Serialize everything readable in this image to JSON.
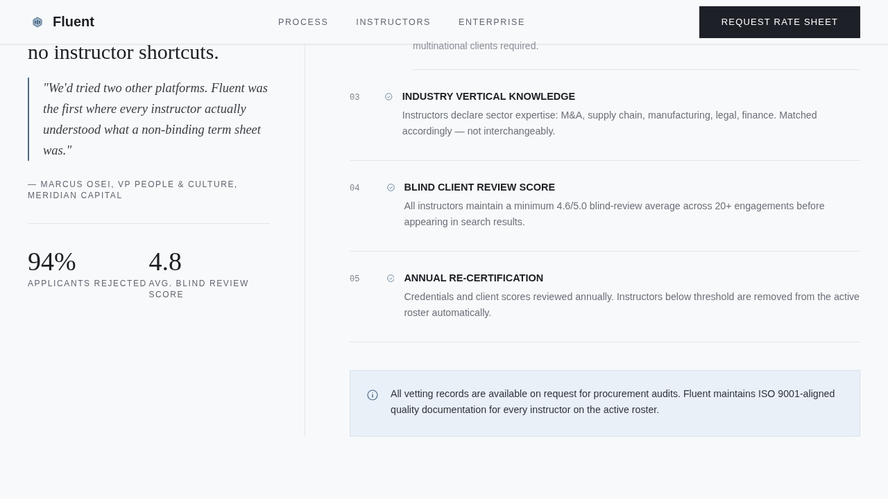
{
  "header": {
    "brand": "Fluent",
    "nav": [
      {
        "label": "PROCESS"
      },
      {
        "label": "INSTRUCTORS"
      },
      {
        "label": "ENTERPRISE"
      }
    ],
    "cta": "REQUEST RATE SHEET"
  },
  "left": {
    "heading": "no instructor shortcuts.",
    "quote": "\"We'd tried two other platforms. Fluent was the first where every instructor actually understood what a non-binding term sheet was.\"",
    "attribution": "— MARCUS OSEI, VP PEOPLE & CULTURE, MERIDIAN CAPITAL",
    "stats": [
      {
        "value": "94%",
        "label": "APPLICANTS REJECTED"
      },
      {
        "value": "4.8",
        "label": "AVG. BLIND REVIEW SCORE"
      }
    ]
  },
  "steps_tail": "multinational clients required.",
  "steps": [
    {
      "number": "03",
      "title": "INDUSTRY VERTICAL KNOWLEDGE",
      "text": "Instructors declare sector expertise: M&A, supply chain, manufacturing, legal, finance. Matched accordingly — not interchangeably."
    },
    {
      "number": "04",
      "title": "BLIND CLIENT REVIEW SCORE",
      "text": "All instructors maintain a minimum 4.6/5.0 blind-review average across 20+ engagements before appearing in search results."
    },
    {
      "number": "05",
      "title": "ANNUAL RE-CERTIFICATION",
      "text": "Credentials and client scores reviewed annually. Instructors below threshold are removed from the active roster automatically."
    }
  ],
  "notice": "All vetting records are available on request for procurement audits. Fluent maintains ISO 9001-aligned quality documentation for every instructor on the active roster."
}
